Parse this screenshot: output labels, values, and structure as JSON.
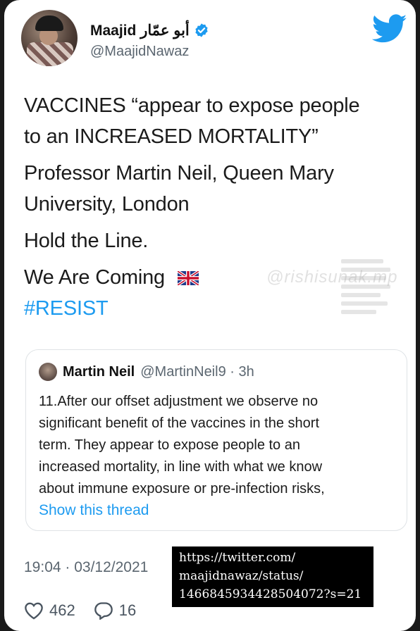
{
  "tweet": {
    "display_name": "Maajid أبو عمّار",
    "handle": "@MaajidNawaz",
    "lines": [
      "VACCINES “appear to expose people",
      "to an INCREASED MORTALITY”",
      "Professor Martin Neil, Queen Mary",
      "University, London",
      "Hold the Line.",
      "We Are Coming"
    ],
    "hashtag": "#RESIST",
    "timestamp": "19:04 · 03/12/2021",
    "likes": "462",
    "replies": "16"
  },
  "quoted": {
    "name": "Martin Neil",
    "handle": "@MartinNeil9 · 3h",
    "lines": [
      "11.After our offset adjustment we observe no",
      "significant benefit of the vaccines in the short",
      "term. They appear to expose people to an",
      "increased mortality, in line with what we know",
      "about immune exposure or pre-infection risks,"
    ],
    "show_thread": "Show this thread"
  },
  "overlay": {
    "url_lines": [
      "https://twitter.com/",
      "maajidnawaz/status/",
      "1466845934428504072?s=21"
    ],
    "watermark": "@rishisunak.mp"
  },
  "colors": {
    "accent": "#1d9bf0",
    "text": "#1b1b1b",
    "muted": "#5b6670"
  },
  "icons": [
    "verified-badge-icon",
    "twitter-bird-icon",
    "uk-flag-icon",
    "heart-icon",
    "reply-icon"
  ]
}
